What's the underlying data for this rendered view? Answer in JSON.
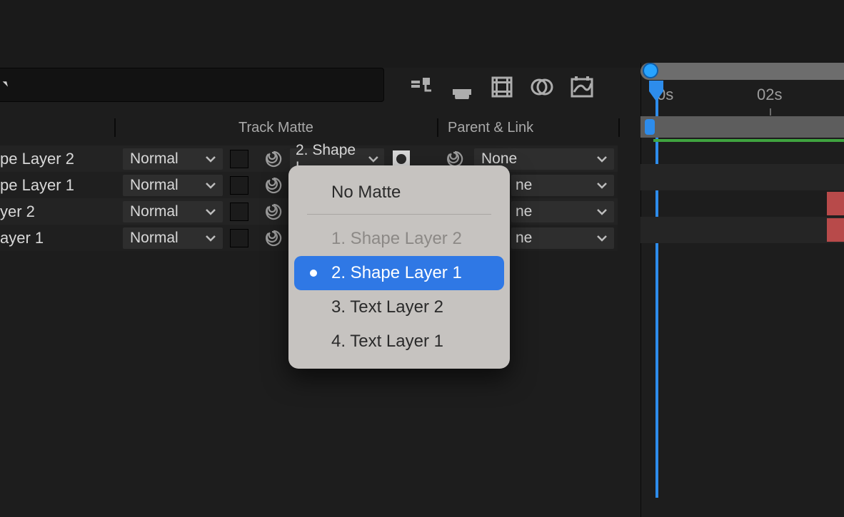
{
  "columns": {
    "trackmatte_label": "Track Matte",
    "parent_label": "Parent & Link"
  },
  "timeline": {
    "ruler_00": "0s",
    "ruler_02": "02s"
  },
  "layers": [
    {
      "name": "pe Layer 2",
      "mode": "Normal",
      "matte": "2. Shape L",
      "parent": "None"
    },
    {
      "name": "pe Layer 1",
      "mode": "Normal",
      "matte": "",
      "parent_tail": "ne"
    },
    {
      "name": "yer 2",
      "mode": "Normal",
      "matte": "",
      "parent_tail": "ne"
    },
    {
      "name": "ayer 1",
      "mode": "Normal",
      "matte": "",
      "parent_tail": "ne"
    }
  ],
  "matte_popup": {
    "no_matte": "No Matte",
    "items": [
      {
        "label": "1. Shape Layer 2",
        "disabled": true,
        "selected": false
      },
      {
        "label": "2. Shape Layer 1",
        "disabled": false,
        "selected": true
      },
      {
        "label": "3. Text Layer 2",
        "disabled": false,
        "selected": false
      },
      {
        "label": "4. Text Layer 1",
        "disabled": false,
        "selected": false
      }
    ]
  }
}
